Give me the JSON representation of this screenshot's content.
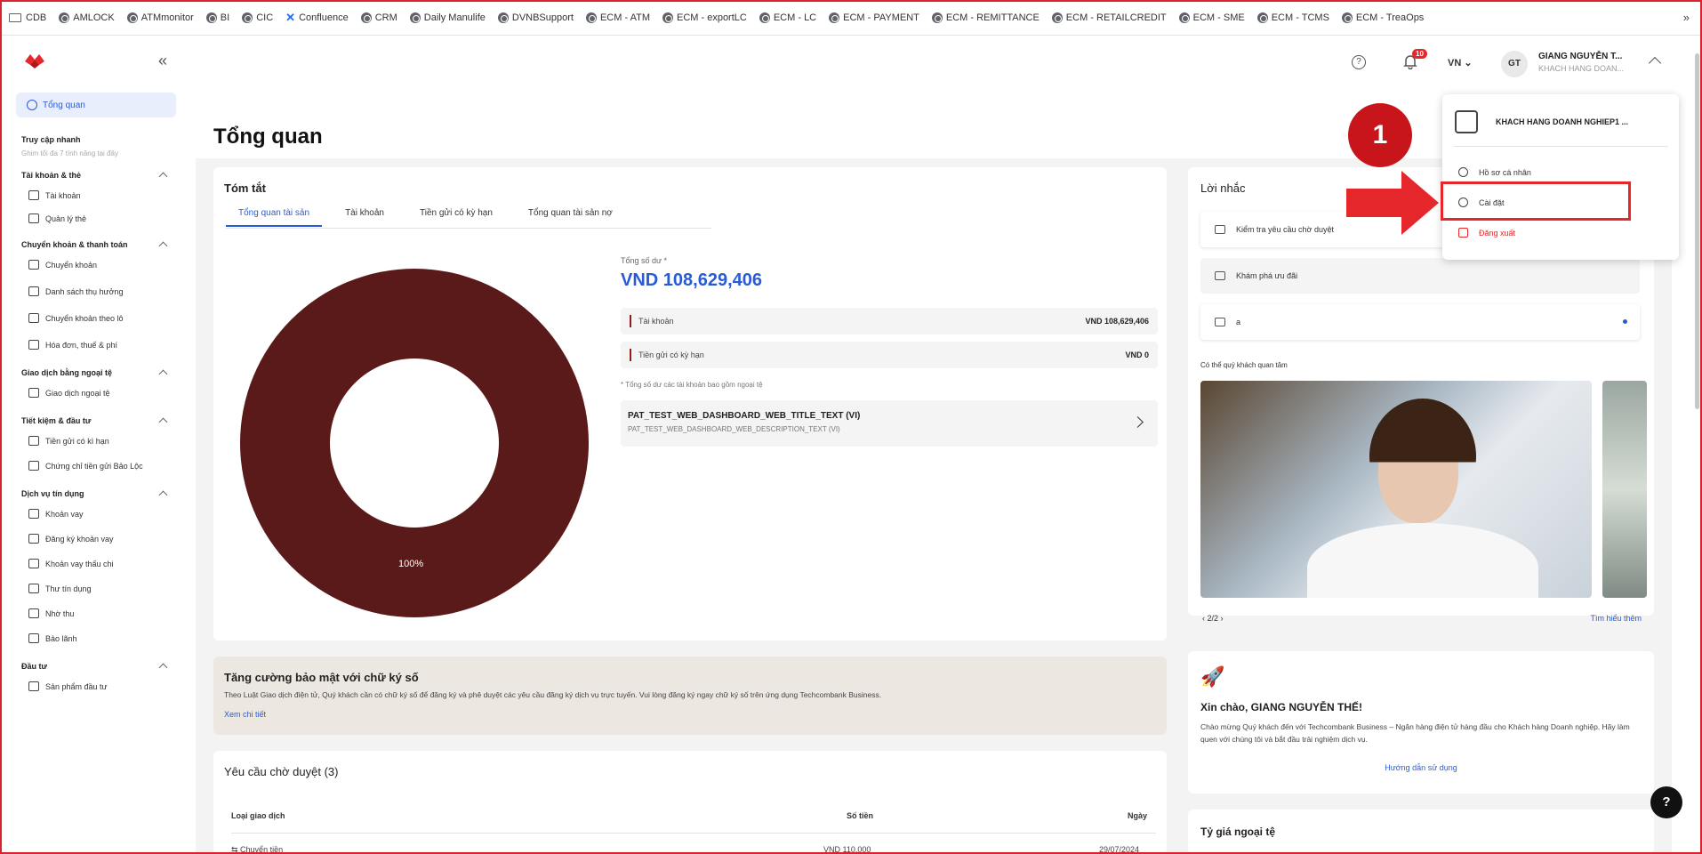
{
  "bookmarks": [
    {
      "label": "CDB",
      "icon": "folder-icon"
    },
    {
      "label": "AMLOCK",
      "icon": "globe-icon"
    },
    {
      "label": "ATMmonitor",
      "icon": "globe-icon"
    },
    {
      "label": "BI",
      "icon": "globe-icon"
    },
    {
      "label": "CIC",
      "icon": "globe-icon"
    },
    {
      "label": "Confluence",
      "icon": "confluence-icon"
    },
    {
      "label": "CRM",
      "icon": "globe-icon"
    },
    {
      "label": "Daily Manulife",
      "icon": "globe-icon"
    },
    {
      "label": "DVNBSupport",
      "icon": "globe-icon"
    },
    {
      "label": "ECM - ATM",
      "icon": "globe-icon"
    },
    {
      "label": "ECM - exportLC",
      "icon": "globe-icon"
    },
    {
      "label": "ECM - LC",
      "icon": "globe-icon"
    },
    {
      "label": "ECM - PAYMENT",
      "icon": "globe-icon"
    },
    {
      "label": "ECM - REMITTANCE",
      "icon": "globe-icon"
    },
    {
      "label": "ECM - RETAILCREDIT",
      "icon": "globe-icon"
    },
    {
      "label": "ECM - SME",
      "icon": "globe-icon"
    },
    {
      "label": "ECM - TCMS",
      "icon": "globe-icon"
    },
    {
      "label": "ECM - TreaOps",
      "icon": "globe-icon"
    }
  ],
  "bookmarks_more": "»",
  "header": {
    "collapse": "«",
    "help": "?",
    "notif_count": "10",
    "lang": "VN",
    "avatar": "GT",
    "user_name": "GIANG NGUYỄN T...",
    "user_sub": "KHACH HANG DOAN..."
  },
  "sidebar": {
    "active": "Tổng quan",
    "quick_title": "Truy cập nhanh",
    "quick_note": "Ghim tối đa 7 tính năng tại đây",
    "groups": [
      {
        "title": "Tài khoản & thẻ",
        "items": [
          "Tài khoản",
          "Quản lý thẻ"
        ]
      },
      {
        "title": "Chuyển khoản & thanh toán",
        "items": [
          "Chuyển khoản",
          "Danh sách thụ hưởng",
          "Chuyển khoản theo lô",
          "Hóa đơn, thuế & phí"
        ]
      },
      {
        "title": "Giao dịch bằng ngoại tệ",
        "items": [
          "Giao dịch ngoại tệ"
        ]
      },
      {
        "title": "Tiết kiệm & đầu tư",
        "items": [
          "Tiền gửi có kì hạn",
          "Chứng chỉ tiền gửi Bảo Lộc"
        ]
      },
      {
        "title": "Dịch vụ tín dụng",
        "items": [
          "Khoản vay",
          "Đăng ký khoản vay",
          "Khoản vay thấu chi",
          "Thư tín dụng",
          "Nhờ thu",
          "Bảo lãnh"
        ]
      },
      {
        "title": "Đầu tư",
        "items": [
          "Sản phẩm đầu tư"
        ]
      }
    ]
  },
  "page_title": "Tổng quan",
  "summary": {
    "title": "Tóm tắt",
    "tabs": [
      "Tổng quan tài sản",
      "Tài khoản",
      "Tiền gửi có kỳ hạn",
      "Tổng quan tài sản nợ"
    ],
    "donut_label": "100%",
    "donut_color": "#5a1a1a",
    "total_label": "Tổng số dư *",
    "total_value": "VND 108,629,406",
    "rows": [
      {
        "label": "Tài khoản",
        "value": "VND 108,629,406"
      },
      {
        "label": "Tiền gửi có kỳ hạn",
        "value": "VND 0"
      }
    ],
    "note": "* Tổng số dư các tài khoản bao gồm ngoại tệ",
    "pat_title": "PAT_TEST_WEB_DASHBOARD_WEB_TITLE_TEXT (VI)",
    "pat_desc": "PAT_TEST_WEB_DASHBOARD_WEB_DESCRIPTION_TEXT (VI)"
  },
  "security": {
    "title": "Tăng cường bảo mật với chữ ký số",
    "text": "Theo Luật Giao dịch điện tử, Quý khách cần có chữ ký số để đăng ký và phê duyệt các yêu cầu đăng ký dịch vụ trực tuyến. Vui lòng đăng ký ngay chữ ký số trên ứng dụng Techcombank Business.",
    "link": "Xem chi tiết"
  },
  "pending": {
    "title": "Yêu cầu chờ duyệt (3)",
    "headers": [
      "Loại giao dịch",
      "Số tiền",
      "Ngày"
    ],
    "row": [
      "Chuyển tiền",
      "VND 110,000",
      "29/07/2024"
    ]
  },
  "reminder": {
    "title": "Lời nhắc",
    "items": [
      "Kiểm tra yêu cầu chờ duyệt",
      "Khám phá ưu đãi",
      "a"
    ],
    "interest": "Có thể quý khách quan tâm",
    "pager": "2/2",
    "learn": "Tìm hiểu thêm"
  },
  "welcome": {
    "title": "Xin chào, GIANG NGUYỄN THẾ!",
    "text": "Chào mừng Quý khách đến với Techcombank Business – Ngân hàng điện tử hàng đầu cho Khách hàng Doanh nghiệp. Hãy làm quen với chúng tôi và bắt đầu trải nghiệm dịch vụ.",
    "link": "Hướng dẫn sử dụng"
  },
  "fx": {
    "title": "Tỷ giá ngoại tệ"
  },
  "help_fab": "?",
  "dropdown": {
    "company": "KHACH HANG DOANH NGHIEP1 ...",
    "items": [
      "Hồ sơ cá nhân",
      "Cài đặt",
      "Đăng xuất"
    ]
  },
  "step": "1",
  "colors": {
    "brand_red": "#e5262a",
    "accent_blue": "#2a5bd7"
  }
}
